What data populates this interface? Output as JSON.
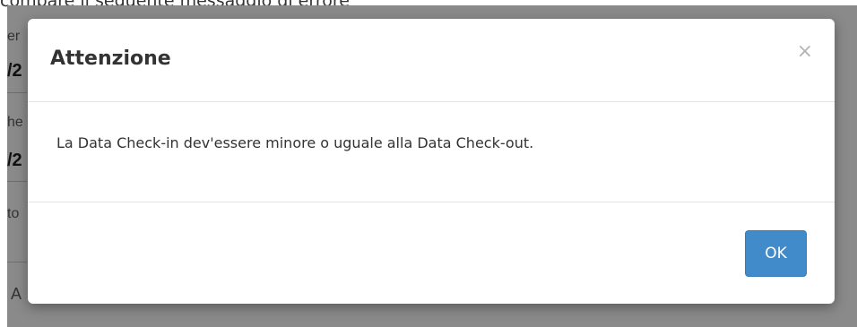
{
  "caption": "compare il seguente messaggio di errore",
  "background": {
    "fragments": [
      "er",
      "/2",
      "he",
      "/2",
      "to",
      "A"
    ]
  },
  "dialog": {
    "title": "Attenzione",
    "close_symbol": "×",
    "message": "La Data Check-in dev'essere minore o uguale alla Data Check-out.",
    "ok_label": "OK"
  }
}
